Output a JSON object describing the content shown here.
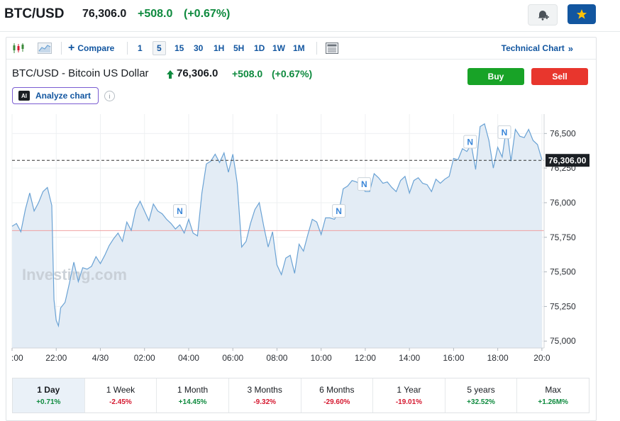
{
  "header": {
    "symbol": "BTC/USD",
    "last": "76,306.0",
    "change": "+508.0",
    "change_pct": "(+0.67%)",
    "bell_icon": "bell-plus-icon",
    "star_icon": "star-icon"
  },
  "toolbar": {
    "candles_icon": "candlestick-icon",
    "area_icon": "area-chart-icon",
    "compare_label": "Compare",
    "intervals": [
      "1",
      "5",
      "15",
      "30",
      "1H",
      "5H",
      "1D",
      "1W",
      "1M"
    ],
    "selected_interval": "5",
    "layout_icon": "layout-icon",
    "technical_chart_label": "Technical Chart"
  },
  "chart_header": {
    "title": "BTC/USD - Bitcoin US Dollar",
    "price": "76,306.0",
    "change": "+508.0",
    "change_pct": "(+0.67%)",
    "buy_label": "Buy",
    "sell_label": "Sell",
    "analyze_label": "Analyze chart",
    "ai_badge": "AI",
    "info_glyph": "i"
  },
  "colors": {
    "line": "#6aa2d4",
    "fill": "#e3ecf5",
    "positive": "#0e8a3e",
    "negative": "#d5182f",
    "prev_close_line": "#f0a0a0",
    "brand_blue": "#1256a0"
  },
  "chart_data": {
    "type": "area",
    "watermark": "Investing.com",
    "x_ticks": [
      ":00",
      "22:00",
      "4/30",
      "02:00",
      "04:00",
      "06:00",
      "08:00",
      "10:00",
      "12:00",
      "14:00",
      "16:00",
      "18:00",
      "20:0"
    ],
    "x_tick_hours": [
      -4,
      -2,
      0,
      2,
      4,
      6,
      8,
      10,
      12,
      14,
      16,
      18,
      20
    ],
    "y_ticks": [
      75000,
      75250,
      75500,
      75750,
      76000,
      76250,
      76500
    ],
    "y_tick_labels": [
      "75,000",
      "75,250",
      "75,500",
      "75,750",
      "76,000",
      "76,250",
      "76,500"
    ],
    "ylim": [
      74950,
      76640
    ],
    "xlim": [
      -4,
      20.1
    ],
    "current_value": 76306,
    "current_label": "76,306.00",
    "prev_close": 75798,
    "news_markers": [
      {
        "label": "N",
        "t": 3.6,
        "y": 75940
      },
      {
        "label": "N",
        "t": 10.8,
        "y": 75940
      },
      {
        "label": "N",
        "t": 11.95,
        "y": 76135
      },
      {
        "label": "N",
        "t": 16.75,
        "y": 76440
      },
      {
        "label": "N",
        "t": 18.3,
        "y": 76510
      }
    ],
    "series": [
      {
        "t": [
          -4.0,
          -3.8,
          -3.6,
          -3.4,
          -3.2,
          -3.0,
          -2.8,
          -2.6,
          -2.4,
          -2.2,
          -2.1,
          -2.0,
          -1.9,
          -1.8,
          -1.6,
          -1.4,
          -1.2,
          -1.0,
          -0.8,
          -0.6,
          -0.4,
          -0.2,
          0.0,
          0.2,
          0.4,
          0.6,
          0.8,
          1.0,
          1.2,
          1.4,
          1.6,
          1.8,
          2.0,
          2.2,
          2.4,
          2.6,
          2.8,
          3.0,
          3.2,
          3.4,
          3.6,
          3.8,
          4.0,
          4.2,
          4.4,
          4.6,
          4.8,
          5.0,
          5.2,
          5.4,
          5.6,
          5.8,
          6.0,
          6.1,
          6.2,
          6.4,
          6.6,
          6.8,
          7.0,
          7.2,
          7.4,
          7.6,
          7.8,
          8.0,
          8.2,
          8.4,
          8.6,
          8.8,
          9.0,
          9.2,
          9.4,
          9.6,
          9.8,
          10.0,
          10.2,
          10.4,
          10.6,
          10.8,
          11.0,
          11.2,
          11.4,
          11.6,
          11.8,
          12.0,
          12.2,
          12.4,
          12.6,
          12.8,
          13.0,
          13.2,
          13.4,
          13.6,
          13.8,
          14.0,
          14.2,
          14.4,
          14.6,
          14.8,
          15.0,
          15.2,
          15.4,
          15.6,
          15.8,
          16.0,
          16.2,
          16.4,
          16.6,
          16.8,
          17.0,
          17.2,
          17.4,
          17.6,
          17.8,
          18.0,
          18.2,
          18.4,
          18.6,
          18.8,
          19.0,
          19.2,
          19.4,
          19.6,
          19.8,
          20.0
        ],
        "values": [
          75830,
          75850,
          75790,
          75950,
          76070,
          75940,
          76000,
          76080,
          76110,
          75980,
          75300,
          75150,
          75110,
          75240,
          75280,
          75420,
          75570,
          75430,
          75530,
          75520,
          75540,
          75610,
          75560,
          75620,
          75690,
          75740,
          75780,
          75720,
          75860,
          75800,
          75950,
          76010,
          75940,
          75870,
          75990,
          75940,
          75920,
          75880,
          75850,
          75810,
          75840,
          75780,
          75880,
          75780,
          75760,
          76070,
          76280,
          76300,
          76350,
          76290,
          76360,
          76220,
          76350,
          76250,
          76140,
          75680,
          75720,
          75850,
          75950,
          76000,
          75830,
          75680,
          75790,
          75550,
          75480,
          75600,
          75620,
          75490,
          75700,
          75650,
          75770,
          75880,
          75860,
          75770,
          75890,
          75890,
          75880,
          75930,
          76100,
          76120,
          76160,
          76150,
          76130,
          76080,
          76080,
          76210,
          76180,
          76140,
          76150,
          76110,
          76080,
          76160,
          76190,
          76070,
          76160,
          76180,
          76140,
          76130,
          76080,
          76170,
          76140,
          76170,
          76190,
          76320,
          76310,
          76390,
          76370,
          76420,
          76240,
          76550,
          76570,
          76450,
          76250,
          76400,
          76330,
          76550,
          76300,
          76530,
          76480,
          76470,
          76530,
          76450,
          76420,
          76310
        ]
      }
    ]
  },
  "periods": [
    {
      "label": "1 Day",
      "change": "+0.71%",
      "dir": "up",
      "active": true
    },
    {
      "label": "1 Week",
      "change": "-2.45%",
      "dir": "down",
      "active": false
    },
    {
      "label": "1 Month",
      "change": "+14.45%",
      "dir": "up",
      "active": false
    },
    {
      "label": "3 Months",
      "change": "-9.32%",
      "dir": "down",
      "active": false
    },
    {
      "label": "6 Months",
      "change": "-29.60%",
      "dir": "down",
      "active": false
    },
    {
      "label": "1 Year",
      "change": "-19.01%",
      "dir": "down",
      "active": false
    },
    {
      "label": "5 years",
      "change": "+32.52%",
      "dir": "up",
      "active": false
    },
    {
      "label": "Max",
      "change": "+1.26M%",
      "dir": "up",
      "active": false
    }
  ]
}
